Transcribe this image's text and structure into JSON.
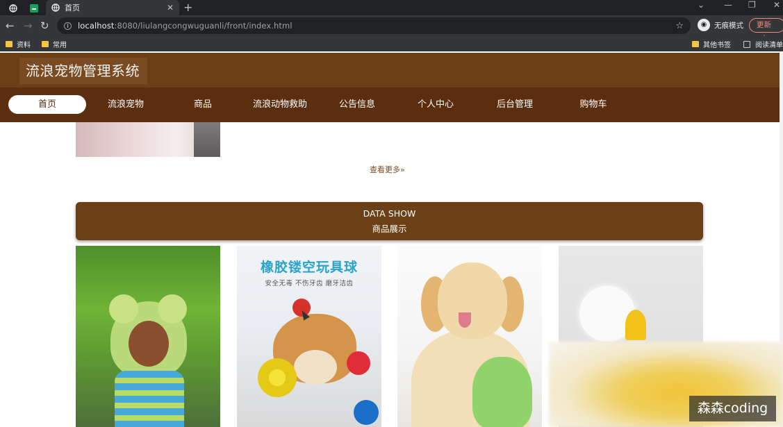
{
  "browser": {
    "tab_title": "首页",
    "new_tab_label": "+",
    "url_host": "localhost",
    "url_rest": ":8080/liulangcongwuguanli/front/index.html",
    "profile_name": "无痕模式",
    "update_label": "更新",
    "update_menu": "⋮",
    "bookmarks": [
      "资料",
      "常用"
    ],
    "bookmarks_right": [
      "其他书签",
      "阅读清单"
    ]
  },
  "site": {
    "title": "流浪宠物管理系统",
    "nav": [
      "首页",
      "流浪宠物",
      "商品",
      "流浪动物救助",
      "公告信息",
      "个人中心",
      "后台管理",
      "购物车"
    ],
    "active_nav": "首页",
    "more_label": "查看更多",
    "more_icon": "»",
    "section_en": "DATA SHOW",
    "section_zh": "商品展示",
    "product_ad_title": "橡胶镂空玩具球",
    "product_ad_sub": "安全无毒 不伤牙齿 磨牙洁齿"
  },
  "watermark": "森森coding",
  "colors": {
    "header": "#6b4016",
    "nav_bar": "#5a2e0f",
    "accent": "#7a4b22"
  }
}
